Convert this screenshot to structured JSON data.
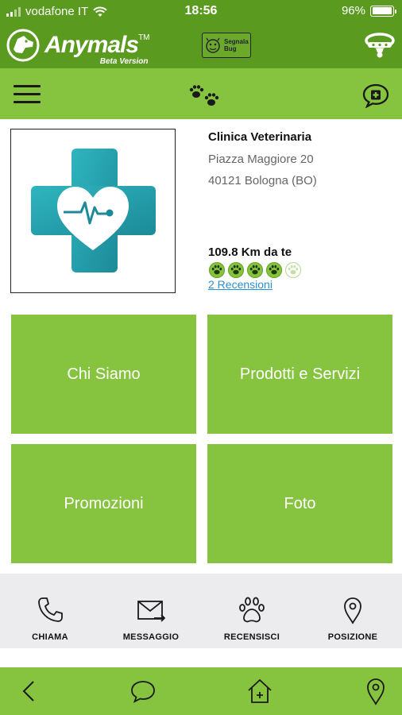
{
  "status_bar": {
    "carrier": "vodafone IT",
    "time": "18:56",
    "battery": "96%",
    "battery_level": 0.96
  },
  "header": {
    "app_name": "Anymals",
    "tm": "TM",
    "app_subtitle": "Beta Version",
    "report_bug_line1": "Segnala",
    "report_bug_line2": "Bug"
  },
  "clinic": {
    "name": "Clinica Veterinaria",
    "address": "Piazza Maggiore 20",
    "city": "40121 Bologna (BO)",
    "distance": "109.8 Km da te",
    "rating": 4,
    "rating_max": 5,
    "reviews_link": "2 Recensioni"
  },
  "tiles": [
    {
      "label": "Chi Siamo"
    },
    {
      "label": "Prodotti e Servizi"
    },
    {
      "label": "Promozioni"
    },
    {
      "label": "Foto"
    }
  ],
  "actions": [
    {
      "label": "CHIAMA",
      "icon": "phone-icon"
    },
    {
      "label": "MESSAGGIO",
      "icon": "message-icon"
    },
    {
      "label": "RECENSISCI",
      "icon": "paw-icon"
    },
    {
      "label": "POSIZIONE",
      "icon": "location-pin-icon"
    }
  ],
  "bottom_nav": [
    {
      "icon": "back-icon"
    },
    {
      "icon": "chat-icon"
    },
    {
      "icon": "home-icon"
    },
    {
      "icon": "location-pin-icon"
    }
  ],
  "colors": {
    "header_green": "#5a9a1f",
    "primary_green": "#86c440",
    "actions_background": "#ececef",
    "link_blue": "#2a8fd3",
    "medical_teal": "#2aa3b0"
  }
}
